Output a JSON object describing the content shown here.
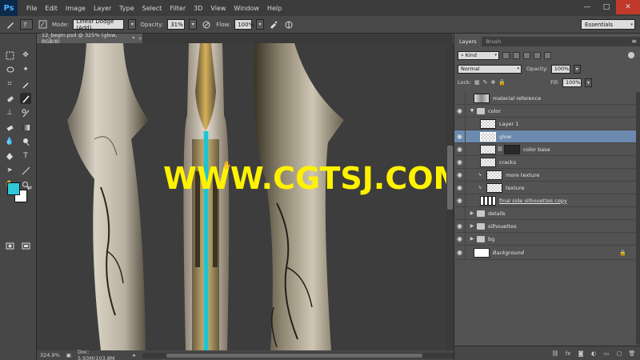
{
  "app": {
    "logo": "Ps",
    "menu": [
      "File",
      "Edit",
      "Image",
      "Layer",
      "Type",
      "Select",
      "Filter",
      "3D",
      "View",
      "Window",
      "Help"
    ],
    "window_controls": {
      "minimize": "—",
      "maximize": "□",
      "close": "✕"
    }
  },
  "options": {
    "brush_size": "7",
    "mode_label": "Mode:",
    "mode_value": "Linear Dodge (Add)",
    "opacity_label": "Opacity:",
    "opacity_value": "31%",
    "flow_label": "Flow:",
    "flow_value": "100%",
    "workspace": "Essentials"
  },
  "document": {
    "tab_title": "12_begin.psd @ 325% (glow, RGB/8)",
    "tab_modified": "*",
    "tab_close": "×",
    "watermark": "WWW.CGTSJ.COM",
    "zoom": "324.9%",
    "doc_size": "Doc: 5.93M/103.8M"
  },
  "colors": {
    "foreground": "#2fc8d8",
    "background": "#ffffff",
    "selected_layer": "#6b8aad",
    "watermark": "#fff200",
    "glow_line": "#1ec3d4"
  },
  "panel": {
    "tabs": [
      "Layers",
      "Brush"
    ],
    "kind_label": "Kind",
    "blend_mode": "Normal",
    "opacity_label": "Opacity:",
    "opacity_value": "100%",
    "lock_label": "Lock:",
    "fill_label": "Fill:",
    "fill_value": "100%",
    "layers": [
      {
        "name": "material reference",
        "visible": false,
        "type": "layer",
        "indent": 0,
        "thumb": "texture"
      },
      {
        "name": "color",
        "visible": true,
        "type": "group-open",
        "indent": 0
      },
      {
        "name": "Layer 1",
        "visible": false,
        "type": "layer",
        "indent": 1,
        "thumb": "transparent"
      },
      {
        "name": "glow",
        "visible": true,
        "type": "layer",
        "indent": 1,
        "thumb": "transparent",
        "selected": true
      },
      {
        "name": "color base",
        "visible": true,
        "type": "layer-mask",
        "indent": 1,
        "thumb": "transparent"
      },
      {
        "name": "cracks",
        "visible": true,
        "type": "layer",
        "indent": 1,
        "thumb": "transparent"
      },
      {
        "name": "more texture",
        "visible": true,
        "type": "clipped",
        "indent": 1,
        "thumb": "transparent"
      },
      {
        "name": "texture",
        "visible": true,
        "type": "clipped",
        "indent": 1,
        "thumb": "transparent"
      },
      {
        "name": "final side silhouettes copy",
        "visible": true,
        "type": "layer",
        "indent": 1,
        "thumb": "silhouette"
      },
      {
        "name": "details",
        "visible": false,
        "type": "group",
        "indent": 0
      },
      {
        "name": "silhouettes",
        "visible": true,
        "type": "group",
        "indent": 0
      },
      {
        "name": "bg",
        "visible": true,
        "type": "group",
        "indent": 0
      },
      {
        "name": "Background",
        "visible": true,
        "type": "background",
        "indent": 0,
        "thumb": "white"
      }
    ]
  },
  "icons": {
    "eye": "eye-icon",
    "lock": "lock-icon",
    "folder": "folder-icon"
  }
}
